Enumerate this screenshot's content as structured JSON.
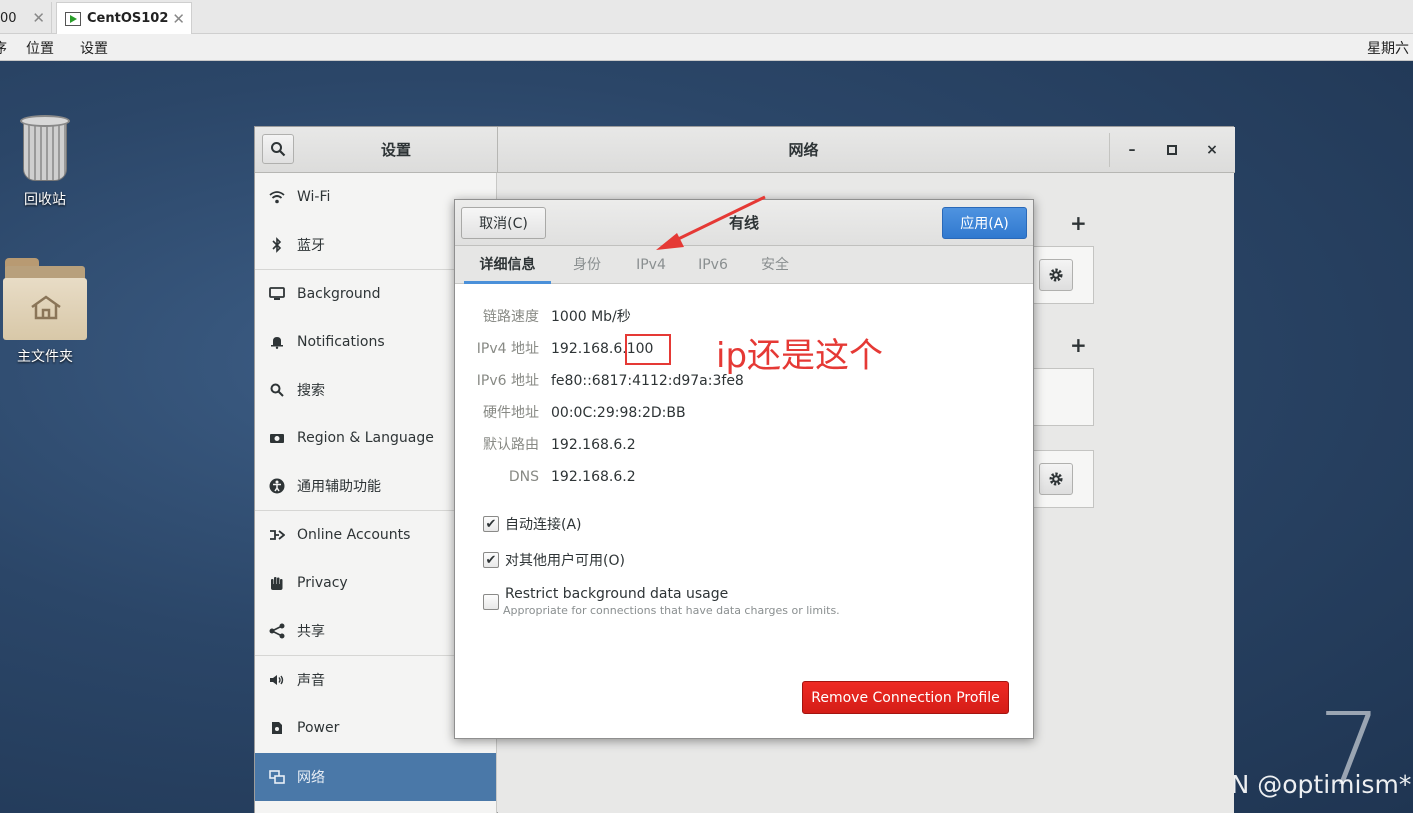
{
  "vm_tabs": [
    {
      "label": "00"
    },
    {
      "label": "CentOS102"
    }
  ],
  "gnome_bar": {
    "left_cut": "序",
    "places": "位置",
    "settings": "设置",
    "clock": "星期六"
  },
  "desktop": {
    "trash_label": "回收站",
    "home_label": "主文件夹",
    "version_mark": "7",
    "watermark": "CSDN @optimism*"
  },
  "settings_window": {
    "left_title": "设置",
    "right_title": "网络",
    "minimize": "–",
    "maximize": "□",
    "close": "×",
    "sidebar": [
      {
        "label": "Wi-Fi",
        "icon": "wifi-icon"
      },
      {
        "label": "蓝牙",
        "icon": "bluetooth-icon"
      },
      {
        "label": "Background",
        "icon": "display-icon"
      },
      {
        "label": "Notifications",
        "icon": "bell-icon"
      },
      {
        "label": "搜索",
        "icon": "search-icon"
      },
      {
        "label": "Region & Language",
        "icon": "camera-icon"
      },
      {
        "label": "通用辅助功能",
        "icon": "accessibility-icon"
      },
      {
        "label": "Online Accounts",
        "icon": "online-accounts-icon"
      },
      {
        "label": "Privacy",
        "icon": "hand-icon"
      },
      {
        "label": "共享",
        "icon": "share-icon"
      },
      {
        "label": "声音",
        "icon": "speaker-icon"
      },
      {
        "label": "Power",
        "icon": "power-plug-icon"
      },
      {
        "label": "网络",
        "icon": "network-icon"
      }
    ],
    "active_item": "网络"
  },
  "dialog": {
    "cancel": "取消(C)",
    "title": "有线",
    "apply": "应用(A)",
    "tabs": [
      "详细信息",
      "身份",
      "IPv4",
      "IPv6",
      "安全"
    ],
    "active_tab": "详细信息",
    "details": [
      {
        "label": "链路速度",
        "value": "1000 Mb/秒"
      },
      {
        "label": "IPv4 地址",
        "value": "192.168.6.100"
      },
      {
        "label": "IPv6 地址",
        "value": "fe80::6817:4112:d97a:3fe8"
      },
      {
        "label": "硬件地址",
        "value": "00:0C:29:98:2D:BB"
      },
      {
        "label": "默认路由",
        "value": "192.168.6.2"
      },
      {
        "label": "DNS",
        "value": "192.168.6.2"
      }
    ],
    "checkboxes": [
      {
        "label": "自动连接(A)",
        "checked": true
      },
      {
        "label": "对其他用户可用(O)",
        "checked": true
      },
      {
        "label": "Restrict background data usage",
        "checked": false,
        "sub": "Appropriate for connections that have data charges or limits."
      }
    ],
    "remove_button": "Remove Connection Profile"
  },
  "annotation": {
    "text": "ip还是这个",
    "color": "#e53935"
  },
  "colors": {
    "accent": "#4a78a8",
    "apply_blue": "#3079cf",
    "remove_red": "#d41d17"
  }
}
